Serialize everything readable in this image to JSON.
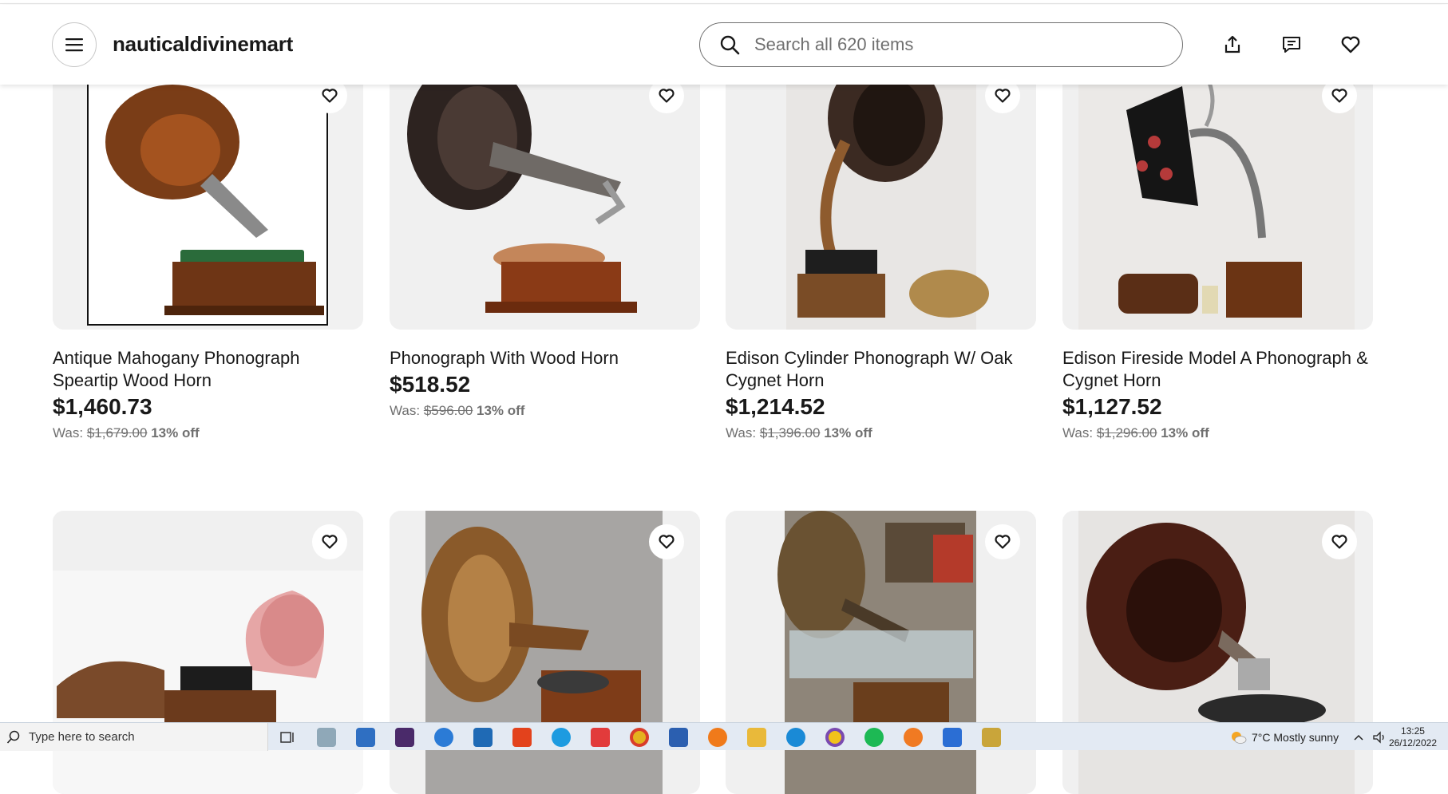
{
  "header": {
    "store_name": "nauticaldivinemart",
    "search_placeholder": "Search all 620 items"
  },
  "listings": [
    {
      "title": "Antique Mahogany Phonograph Speartip Wood Horn",
      "price": "$1,460.73",
      "was_label": "Was:",
      "was_price": "$1,679.00",
      "discount": "13% off"
    },
    {
      "title": "Phonograph With Wood Horn",
      "price": "$518.52",
      "was_label": "Was:",
      "was_price": "$596.00",
      "discount": "13% off"
    },
    {
      "title": "Edison Cylinder Phonograph W/ Oak Cygnet Horn",
      "price": "$1,214.52",
      "was_label": "Was:",
      "was_price": "$1,396.00",
      "discount": "13% off"
    },
    {
      "title": "Edison Fireside Model A Phonograph & Cygnet Horn",
      "price": "$1,127.52",
      "was_label": "Was:",
      "was_price": "$1,296.00",
      "discount": "13% off"
    }
  ],
  "taskbar": {
    "search_placeholder": "Type here to search",
    "weather": "7°C  Mostly sunny",
    "time": "13:25",
    "date": "26/12/2022",
    "apps": [
      "task-view",
      "photos",
      "store",
      "app-s",
      "onedrive",
      "photos-blue",
      "office",
      "skype",
      "vivaldi",
      "chrome",
      "mail",
      "firefox",
      "file-explorer",
      "edge",
      "chrome-canary",
      "spotify",
      "vlc",
      "docs",
      "paint"
    ]
  }
}
